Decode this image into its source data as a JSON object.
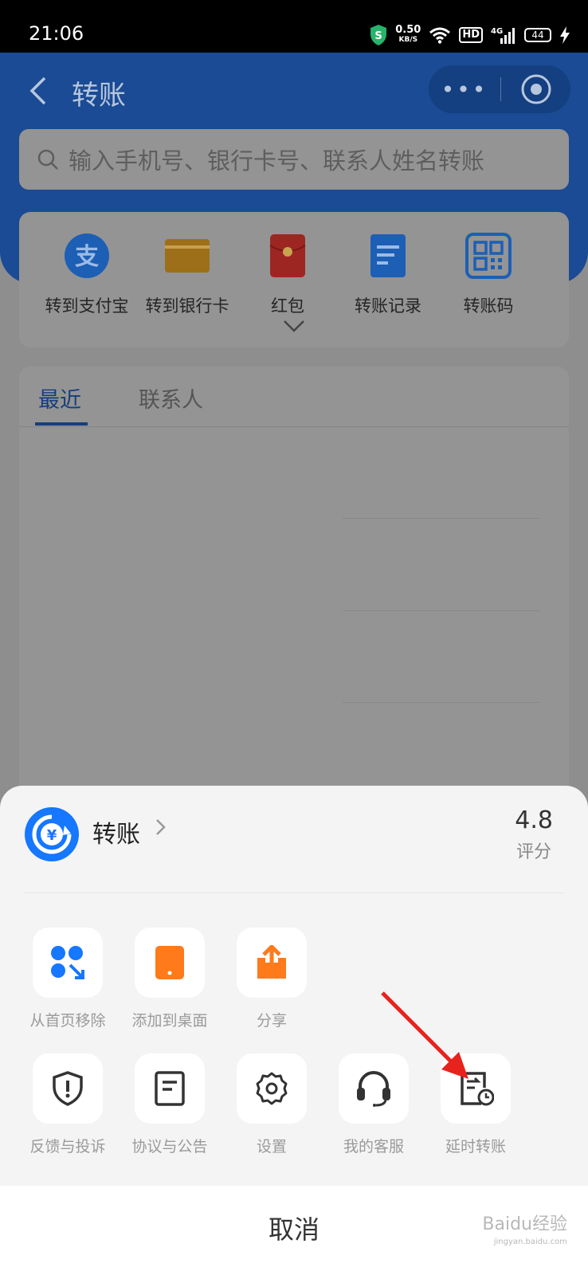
{
  "status_bar": {
    "time": "21:06",
    "speed": "0.50",
    "speed_unit": "KB/S",
    "hd": "HD",
    "network": "4G",
    "battery": "44"
  },
  "header": {
    "title": "转账",
    "more_label": "•••"
  },
  "search": {
    "placeholder": "输入手机号、银行卡号、联系人姓名转账"
  },
  "quick_actions": [
    {
      "label": "转到支付宝",
      "icon": "alipay-icon"
    },
    {
      "label": "转到银行卡",
      "icon": "bank-card-icon"
    },
    {
      "label": "红包",
      "icon": "red-envelope-icon"
    },
    {
      "label": "转账记录",
      "icon": "transfer-record-icon"
    },
    {
      "label": "转账码",
      "icon": "qr-code-icon"
    }
  ],
  "tabs": {
    "recent": "最近",
    "contacts": "联系人"
  },
  "sheet": {
    "app_name": "转账",
    "rating_score": "4.8",
    "rating_label": "评分",
    "row1": [
      {
        "label": "从首页移除",
        "icon": "remove-from-home-icon"
      },
      {
        "label": "添加到桌面",
        "icon": "add-to-desktop-icon"
      },
      {
        "label": "分享",
        "icon": "share-icon"
      }
    ],
    "row2": [
      {
        "label": "反馈与投诉",
        "icon": "feedback-shield-icon"
      },
      {
        "label": "协议与公告",
        "icon": "agreement-icon"
      },
      {
        "label": "设置",
        "icon": "settings-gear-icon"
      },
      {
        "label": "我的客服",
        "icon": "customer-service-headset-icon"
      },
      {
        "label": "延时转账",
        "icon": "delayed-transfer-icon"
      }
    ],
    "cancel": "取消"
  },
  "colors": {
    "header_blue": "#1a4b94",
    "primary_blue": "#1677ff",
    "orange": "#ff7a1a",
    "annotation_red": "#e8221c"
  },
  "watermark": {
    "brand": "Baidu经验",
    "url": "jingyan.baidu.com"
  }
}
